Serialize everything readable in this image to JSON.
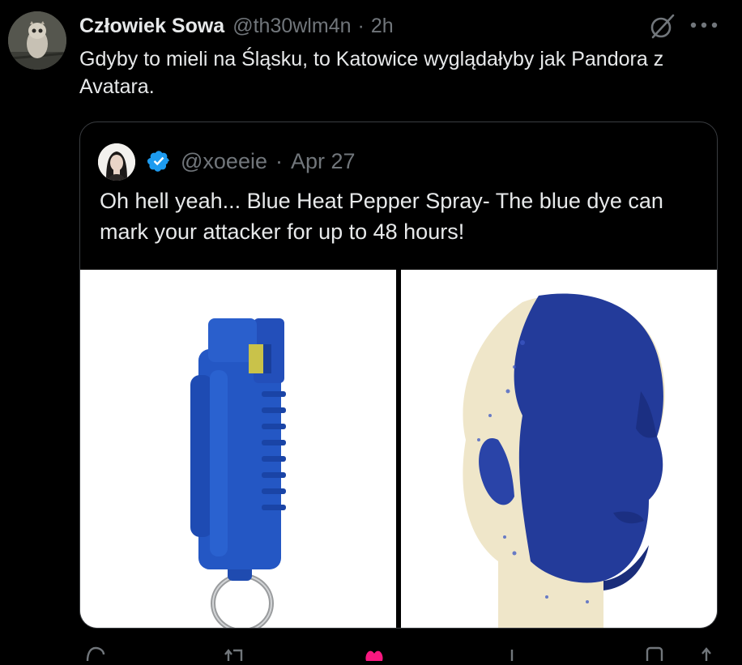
{
  "author": {
    "display_name": "Człowiek Sowa",
    "handle": "@th30wlm4n",
    "separator": "·",
    "time": "2h"
  },
  "tweet": {
    "text": "Gdyby to mieli na Śląsku, to Katowice wyglądałyby jak Pandora z Avatara."
  },
  "quote": {
    "handle": "@xoeeie",
    "separator": "·",
    "date": "Apr 27",
    "text": "Oh hell yeah... Blue Heat Pepper Spray- The blue dye can mark your attacker for up to 48 hours!"
  },
  "icons": {
    "grok": "grok-icon",
    "more": "more-icon",
    "verified": "verified-badge-icon",
    "reply": "reply-icon",
    "retweet": "retweet-icon",
    "like": "like-icon",
    "views": "views-icon",
    "bookmark": "bookmark-icon"
  },
  "colors": {
    "background": "#000000",
    "text_primary": "#e7e9ea",
    "text_secondary": "#71767b",
    "verified_blue": "#1d9bf0",
    "quote_border": "#3a3d41",
    "like_pink": "#f91880"
  }
}
